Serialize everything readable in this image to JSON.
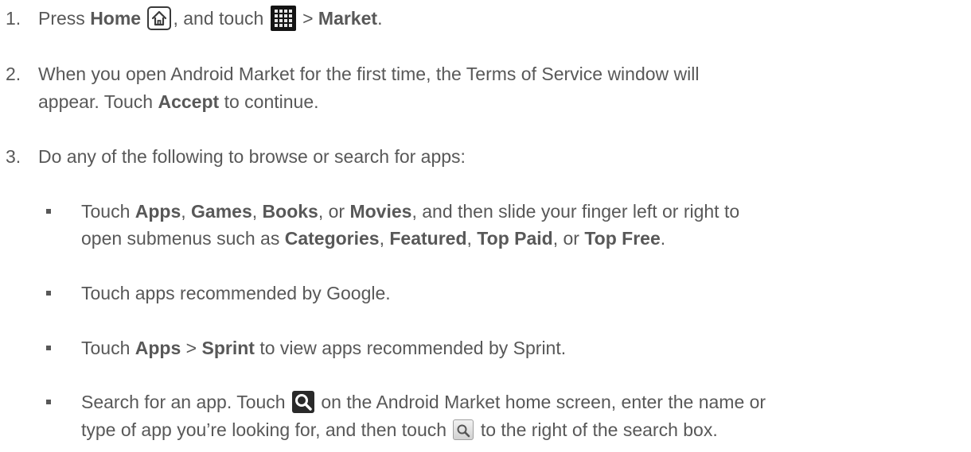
{
  "steps": [
    {
      "number": "1.",
      "parts": {
        "t1": "Press ",
        "b1": "Home",
        "t2": ", and touch ",
        "t3": " > ",
        "b2": "Market",
        "t4": "."
      },
      "icons": [
        "home-key-icon",
        "all-apps-grid-icon"
      ]
    },
    {
      "number": "2.",
      "line1": "When you open Android Market for the first time, the Terms of Service window will",
      "parts": {
        "t1": "appear. Touch ",
        "b1": "Accept",
        "t2": " to continue."
      }
    },
    {
      "number": "3.",
      "text": "Do any of the following to browse or search for apps:"
    }
  ],
  "bullets": [
    {
      "line1": {
        "t1": "Touch ",
        "b1": "Apps",
        "t2": ", ",
        "b2": "Games",
        "t3": ", ",
        "b3": "Books",
        "t4": ", or ",
        "b4": "Movies",
        "t5": ", and then slide your finger left or right to"
      },
      "line2": {
        "t1": "open submenus such as ",
        "b1": "Categories",
        "t2": ", ",
        "b2": "Featured",
        "t3": ", ",
        "b3": "Top Paid",
        "t4": ", or ",
        "b4": "Top Free",
        "t5": "."
      }
    },
    {
      "text": "Touch apps recommended by Google."
    },
    {
      "t1": "Touch ",
      "b1": "Apps",
      "t2": " > ",
      "b2": "Sprint",
      "t3": " to view apps recommended by Sprint."
    },
    {
      "line1": {
        "t1": "Search for an app. Touch ",
        "t2": " on the Android Market home screen, enter the name or"
      },
      "line2": {
        "t1": "type of app you’re looking for, and then touch ",
        "t2": " to the right of the search box."
      },
      "icons": [
        "market-search-icon",
        "search-box-button-icon"
      ]
    }
  ],
  "colors": {
    "text": "#585858",
    "icon_dark": "#141414"
  }
}
